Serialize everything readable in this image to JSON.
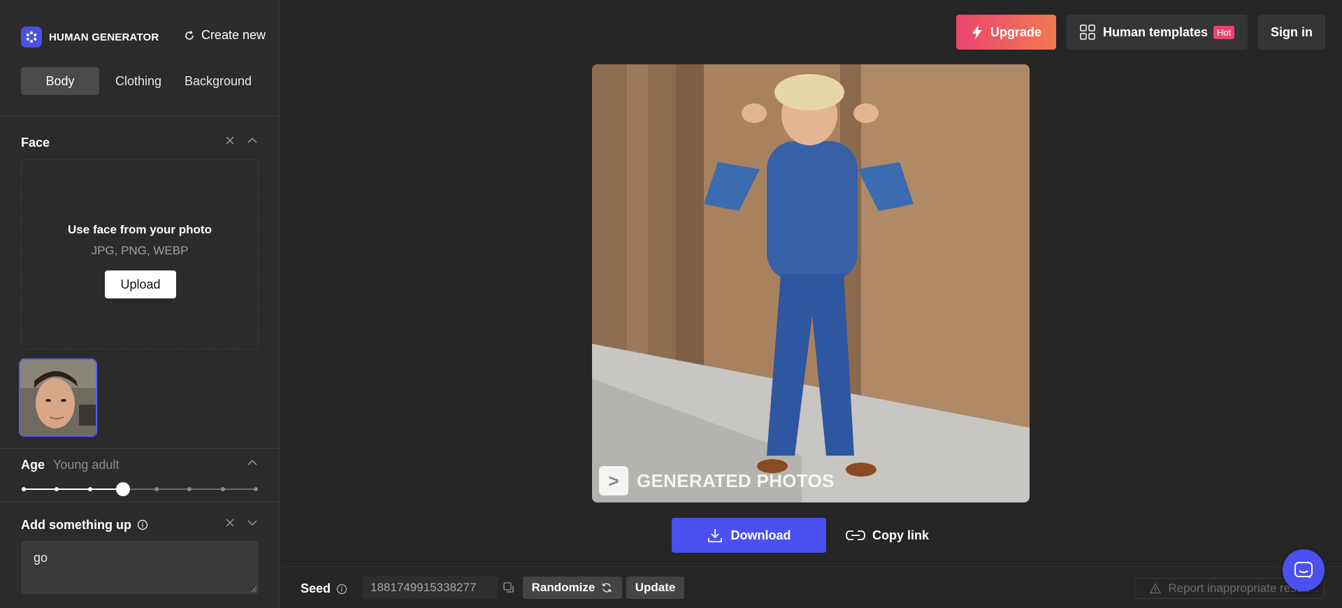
{
  "brand": {
    "name": "HUMAN GENERATOR",
    "create_new": "Create new"
  },
  "tabs": [
    {
      "label": "Body",
      "active": true
    },
    {
      "label": "Clothing",
      "active": false
    },
    {
      "label": "Background",
      "active": false
    }
  ],
  "face": {
    "title": "Face",
    "dropzone_title": "Use face from your photo",
    "dropzone_formats": "JPG, PNG, WEBP",
    "upload_label": "Upload"
  },
  "age": {
    "title": "Age",
    "value": "Young adult",
    "steps": 8,
    "selected_index": 3
  },
  "add_something": {
    "title": "Add something up",
    "text": "go"
  },
  "topbar": {
    "upgrade": "Upgrade",
    "templates": "Human templates",
    "templates_badge": "Hot",
    "signin": "Sign in"
  },
  "image": {
    "watermark": "GENERATED PHOTOS"
  },
  "actions": {
    "download": "Download",
    "copy_link": "Copy link"
  },
  "seed": {
    "label": "Seed",
    "value": "1881749915338277",
    "randomize": "Randomize",
    "update": "Update"
  },
  "report": "Report inappropriate result",
  "colors": {
    "accent": "#4b50f0",
    "upgrade_start": "#e8456f",
    "upgrade_end": "#f07b53",
    "background": "#262626",
    "sidebar": "#2b2b2b"
  }
}
